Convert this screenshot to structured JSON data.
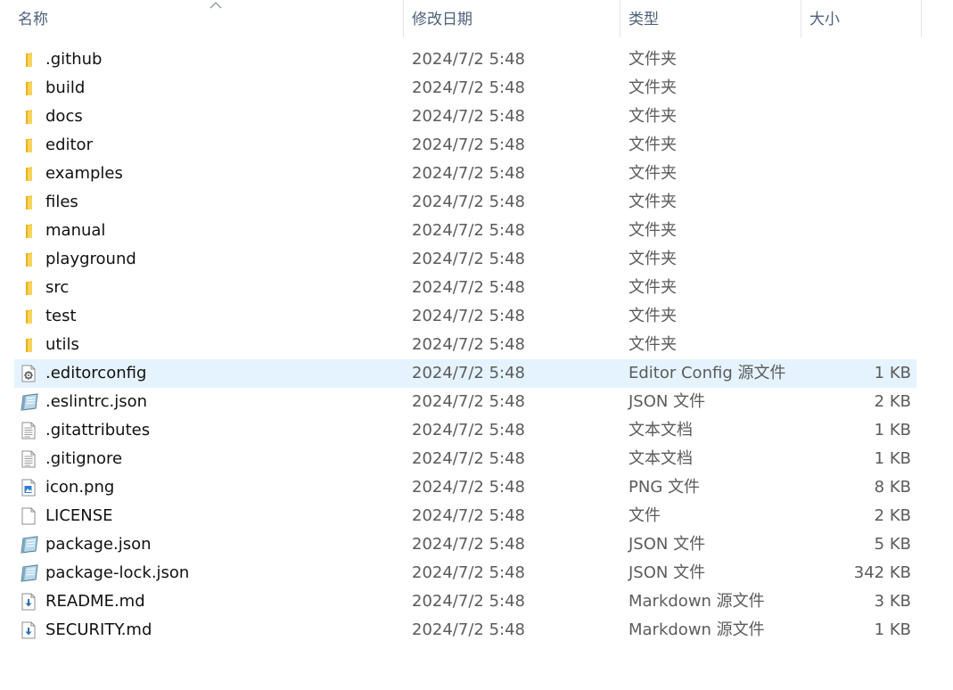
{
  "columns": {
    "name": "名称",
    "modified": "修改日期",
    "type": "类型",
    "size": "大小",
    "sort_icon": "chevron-up-icon"
  },
  "files": [
    {
      "name": ".github",
      "modified": "2024/7/2 5:48",
      "type": "文件夹",
      "size": "",
      "icon": "folder-icon"
    },
    {
      "name": "build",
      "modified": "2024/7/2 5:48",
      "type": "文件夹",
      "size": "",
      "icon": "folder-icon"
    },
    {
      "name": "docs",
      "modified": "2024/7/2 5:48",
      "type": "文件夹",
      "size": "",
      "icon": "folder-icon"
    },
    {
      "name": "editor",
      "modified": "2024/7/2 5:48",
      "type": "文件夹",
      "size": "",
      "icon": "folder-icon"
    },
    {
      "name": "examples",
      "modified": "2024/7/2 5:48",
      "type": "文件夹",
      "size": "",
      "icon": "folder-icon"
    },
    {
      "name": "files",
      "modified": "2024/7/2 5:48",
      "type": "文件夹",
      "size": "",
      "icon": "folder-icon"
    },
    {
      "name": "manual",
      "modified": "2024/7/2 5:48",
      "type": "文件夹",
      "size": "",
      "icon": "folder-icon"
    },
    {
      "name": "playground",
      "modified": "2024/7/2 5:48",
      "type": "文件夹",
      "size": "",
      "icon": "folder-icon"
    },
    {
      "name": "src",
      "modified": "2024/7/2 5:48",
      "type": "文件夹",
      "size": "",
      "icon": "folder-icon"
    },
    {
      "name": "test",
      "modified": "2024/7/2 5:48",
      "type": "文件夹",
      "size": "",
      "icon": "folder-icon"
    },
    {
      "name": "utils",
      "modified": "2024/7/2 5:48",
      "type": "文件夹",
      "size": "",
      "icon": "folder-icon"
    },
    {
      "name": ".editorconfig",
      "modified": "2024/7/2 5:48",
      "type": "Editor Config 源文件",
      "size": "1 KB",
      "icon": "config-file-icon",
      "selected": true
    },
    {
      "name": ".eslintrc.json",
      "modified": "2024/7/2 5:48",
      "type": "JSON 文件",
      "size": "2 KB",
      "icon": "json-file-icon"
    },
    {
      "name": ".gitattributes",
      "modified": "2024/7/2 5:48",
      "type": "文本文档",
      "size": "1 KB",
      "icon": "text-file-icon"
    },
    {
      "name": ".gitignore",
      "modified": "2024/7/2 5:48",
      "type": "文本文档",
      "size": "1 KB",
      "icon": "text-file-icon"
    },
    {
      "name": "icon.png",
      "modified": "2024/7/2 5:48",
      "type": "PNG 文件",
      "size": "8 KB",
      "icon": "image-file-icon"
    },
    {
      "name": "LICENSE",
      "modified": "2024/7/2 5:48",
      "type": "文件",
      "size": "2 KB",
      "icon": "blank-file-icon"
    },
    {
      "name": "package.json",
      "modified": "2024/7/2 5:48",
      "type": "JSON 文件",
      "size": "5 KB",
      "icon": "json-file-icon"
    },
    {
      "name": "package-lock.json",
      "modified": "2024/7/2 5:48",
      "type": "JSON 文件",
      "size": "342 KB",
      "icon": "json-file-icon"
    },
    {
      "name": "README.md",
      "modified": "2024/7/2 5:48",
      "type": "Markdown 源文件",
      "size": "3 KB",
      "icon": "markdown-file-icon"
    },
    {
      "name": "SECURITY.md",
      "modified": "2024/7/2 5:48",
      "type": "Markdown 源文件",
      "size": "1 KB",
      "icon": "markdown-file-icon"
    }
  ],
  "colors": {
    "selection": "#e5f3ff",
    "folder": "#f7c948",
    "header_text": "#4c607a"
  }
}
